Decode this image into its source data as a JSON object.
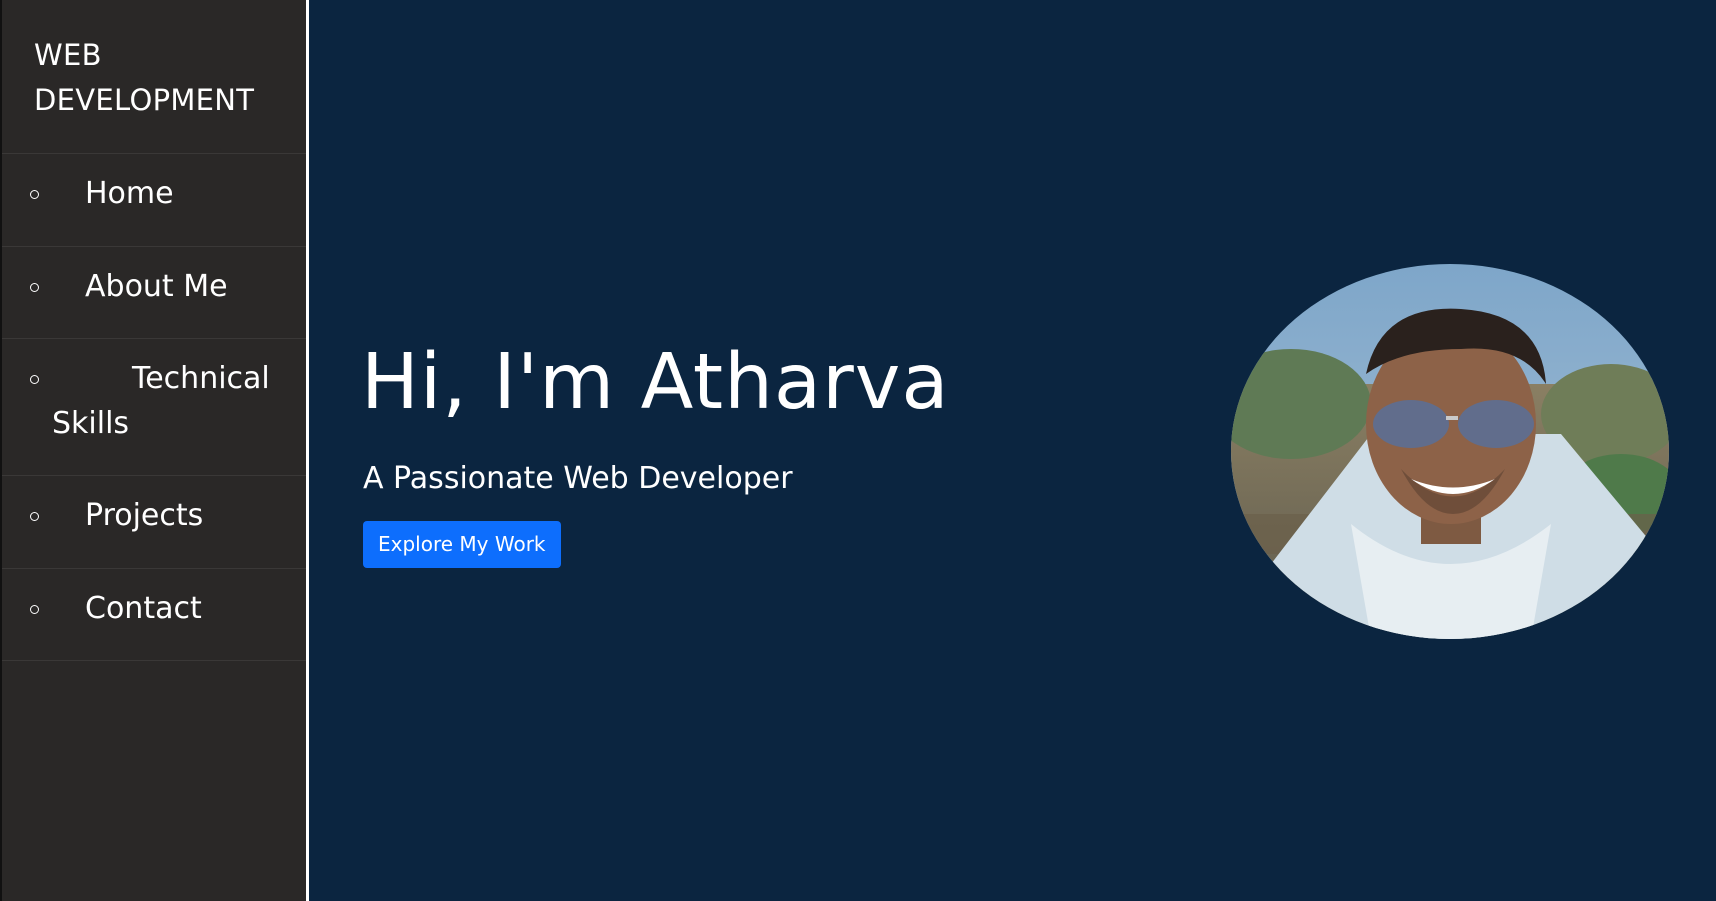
{
  "sidebar": {
    "brand": "WEB DEVELOPMENT",
    "items": [
      {
        "label": "Home"
      },
      {
        "label": "About Me"
      },
      {
        "label": "Technical Skills"
      },
      {
        "label": "Projects"
      },
      {
        "label": "Contact"
      }
    ]
  },
  "hero": {
    "title": "Hi, I'm Atharva",
    "subtitle": "A Passionate Web Developer",
    "cta_label": "Explore My Work"
  },
  "colors": {
    "sidebar_bg": "#2a2827",
    "main_bg": "#0b2540",
    "accent": "#0d6efd",
    "text": "#ffffff"
  }
}
